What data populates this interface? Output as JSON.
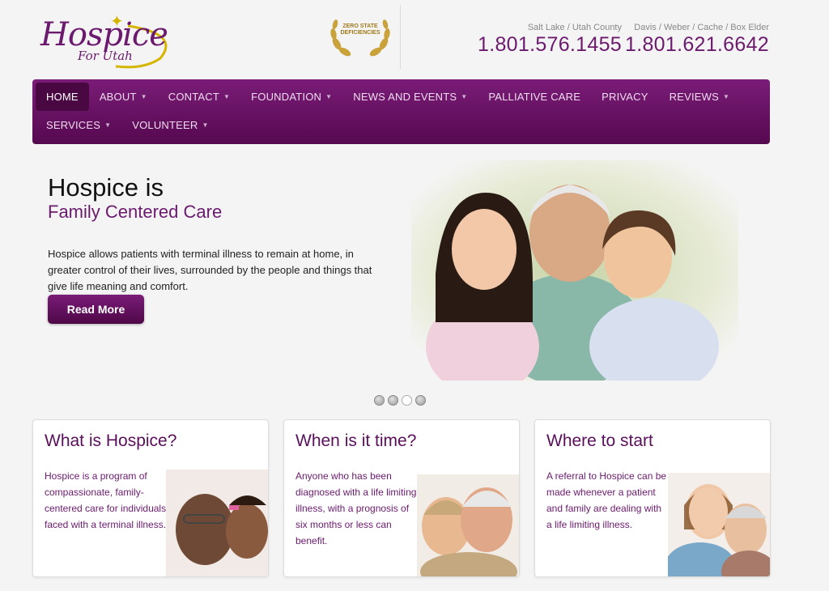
{
  "header": {
    "logo_text": "Hospice",
    "logo_sub": "For Utah",
    "award_text": "ZERO STATE DEFICIENCIES",
    "phones": [
      {
        "area": "Salt Lake / Utah County",
        "number": "1.801.576.1455"
      },
      {
        "area": "Davis / Weber / Cache / Box Elder",
        "number": "1.801.621.6642"
      }
    ]
  },
  "nav": {
    "row1": [
      {
        "label": "HOME",
        "caret": false,
        "active": true
      },
      {
        "label": "ABOUT",
        "caret": true
      },
      {
        "label": "CONTACT",
        "caret": true
      },
      {
        "label": "FOUNDATION",
        "caret": true
      },
      {
        "label": "NEWS AND EVENTS",
        "caret": true
      },
      {
        "label": "PALLIATIVE CARE",
        "caret": false
      },
      {
        "label": "PRIVACY",
        "caret": false
      },
      {
        "label": "REVIEWS",
        "caret": true
      }
    ],
    "row2": [
      {
        "label": "SERVICES",
        "caret": true
      },
      {
        "label": "VOLUNTEER",
        "caret": true
      }
    ],
    "caret_glyph": "▼"
  },
  "hero": {
    "title": "Hospice is",
    "subtitle": "Family Centered Care",
    "body": "Hospice allows patients with terminal illness to remain at home, in greater control of their lives, surrounded by the people and things that give life meaning and comfort.",
    "button": "Read More"
  },
  "slider": {
    "count": 4,
    "current": 3
  },
  "cards": [
    {
      "title": "What is Hospice?",
      "body": "Hospice is a program of compassionate, family-centered care for individuals faced with a terminal illness."
    },
    {
      "title": "When is it time?",
      "body": "Anyone who has been diagnosed with a life limiting illness, with a prognosis of six months or less can benefit."
    },
    {
      "title": "Where to start",
      "body": "A referral to Hospice can be made whenever a patient and family are dealing with a life limiting illness."
    }
  ],
  "colors": {
    "brand": "#6b1a6e",
    "gold": "#d4b600"
  }
}
